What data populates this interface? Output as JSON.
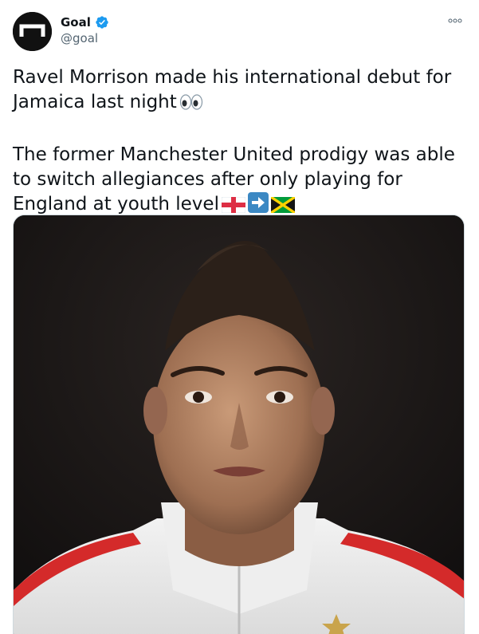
{
  "author": {
    "display_name": "Goal",
    "handle": "@goal",
    "verified": true,
    "avatar_icon": "goal-logo-icon"
  },
  "actions": {
    "more_icon": "more-dots-icon"
  },
  "tweet": {
    "paragraph_1": "Ravel Morrison made his international debut for Jamaica last night",
    "paragraph_1_emoji": "eyes-emoji",
    "paragraph_2": "The former Manchester United prodigy was able to switch allegiances after only playing for England at youth level",
    "paragraph_2_emojis": [
      "england-flag-emoji",
      "right-arrow-emoji",
      "jamaica-flag-emoji"
    ]
  },
  "media": {
    "type": "photo",
    "subject": "football-player-portrait"
  },
  "colors": {
    "verified": "#1d9bf0",
    "handle_gray": "#536471",
    "text": "#0f1419"
  }
}
